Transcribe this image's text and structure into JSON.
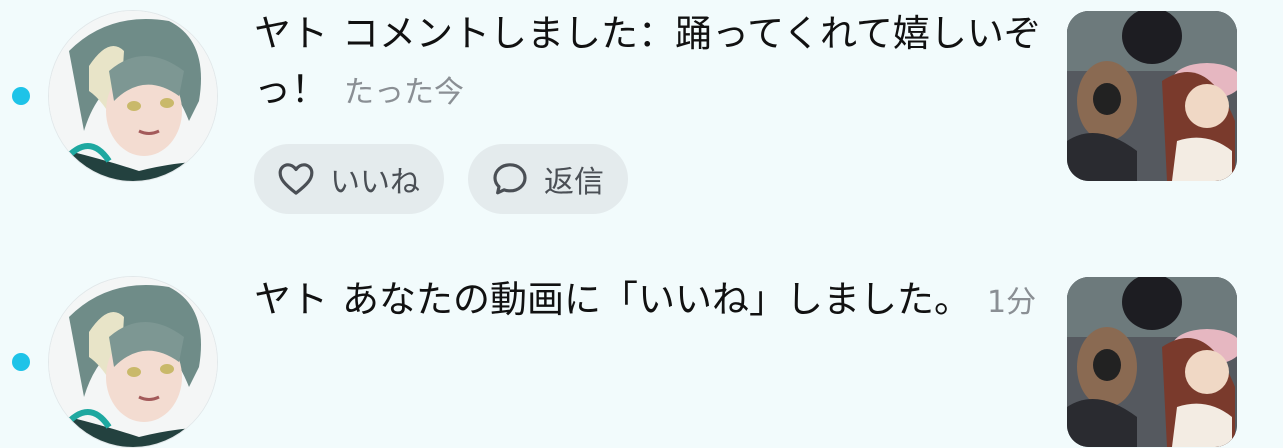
{
  "notifications": [
    {
      "user": "ヤト",
      "message": "コメントしました：踊ってくれて嬉しいぞっ！",
      "time": "たった今",
      "actions": {
        "like_label": "いいね",
        "reply_label": "返信"
      },
      "unread": true
    },
    {
      "user": "ヤト",
      "message": "あなたの動画に「いいね」しました。",
      "time": "1分",
      "unread": true
    }
  ],
  "icons": {
    "heart": "heart-icon",
    "comment": "comment-bubble-icon"
  },
  "colors": {
    "unread_dot": "#1ec3e8",
    "background": "#f2fbfc",
    "pill_bg": "#e4ebed",
    "time_text": "#8a8f94"
  }
}
